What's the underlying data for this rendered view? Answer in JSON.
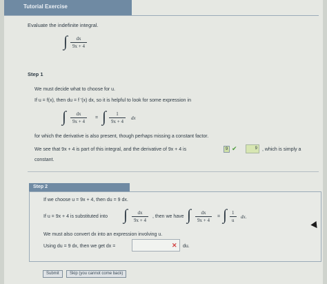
{
  "header": {
    "title": "Tutorial Exercise"
  },
  "prompt": {
    "text": "Evaluate the indefinite integral."
  },
  "main_integral": {
    "symbol": "∫",
    "numerator": "dx",
    "denominator": "9x + 4"
  },
  "step1": {
    "title": "Step 1",
    "line1": "We must decide what to choose for u.",
    "line2": "If u = f(x), then du = f ′(x) dx, so it is helpful to look for some expression in",
    "eq": {
      "int1_num": "dx",
      "int1_den": "9x + 4",
      "equals": "=",
      "int2_num": "1",
      "int2_den": "9x + 4",
      "tail": "dx"
    },
    "line3": "for which the derivative is also present, though perhaps missing a constant factor.",
    "line4_a": "We see that 9x + 4 is part of this integral, and the derivative of 9x + 4 is",
    "answer1": "9",
    "answer2": "9",
    "line4_b": ", which is simply a",
    "line5": "constant."
  },
  "step2": {
    "title": "Step 2",
    "line1": "If we choose u = 9x + 4, then du = 9 dx.",
    "line2_a": "If u = 9x + 4 is substituted into",
    "sub_num": "dx",
    "sub_den": "9x + 4",
    "line2_b": ", then we have",
    "res_num": "dx",
    "res_den": "9x + 4",
    "res_eq": "=",
    "res2_num": "1",
    "res2_den": "u",
    "res_tail": "dx.",
    "line3": "We must also convert dx into an expression involving u.",
    "line4_a": "Using du = 9 dx, then we get dx =",
    "line4_b": "du.",
    "input_value": ""
  },
  "buttons": {
    "submit": "Submit",
    "skip": "Skip (you cannot come back)"
  }
}
